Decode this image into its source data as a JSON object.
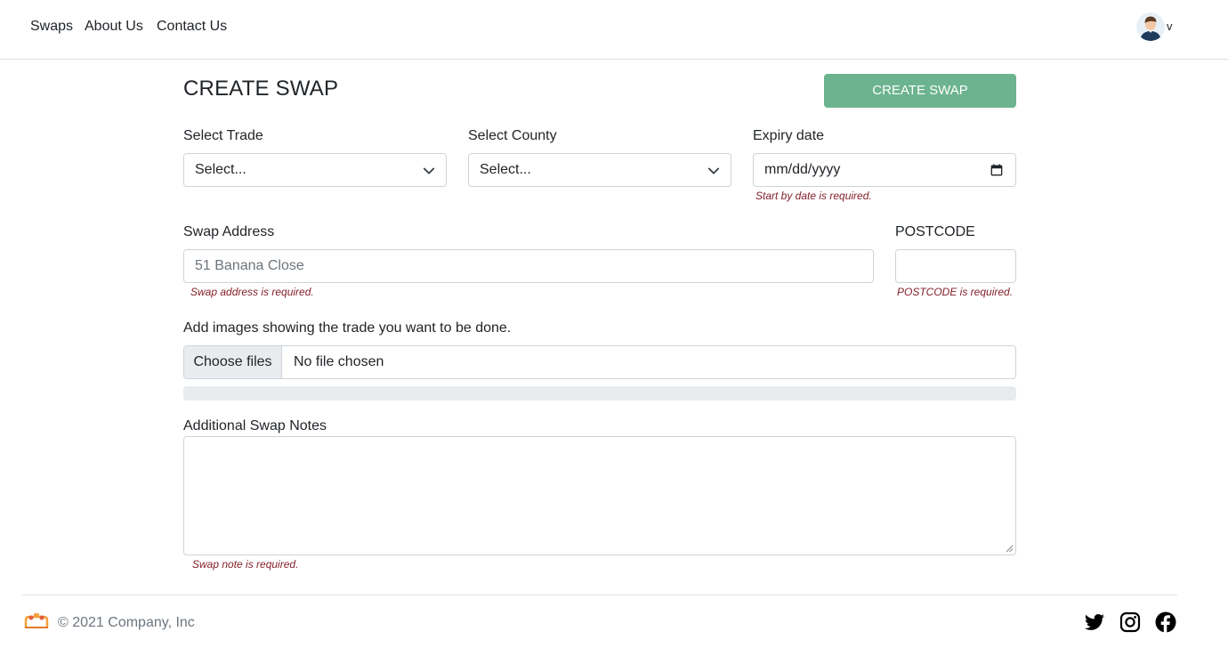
{
  "nav": {
    "links": [
      "Swaps",
      "About Us",
      "Contact Us"
    ],
    "avatar_caret": "v"
  },
  "page": {
    "title": "CREATE SWAP",
    "create_button": "CREATE SWAP"
  },
  "form": {
    "trade": {
      "label": "Select Trade",
      "value": "Select..."
    },
    "county": {
      "label": "Select County",
      "value": "Select..."
    },
    "expiry": {
      "label": "Expiry date",
      "placeholder": "mm/dd/yyyy",
      "error": "Start by date is required."
    },
    "address": {
      "label": "Swap Address",
      "placeholder": "51 Banana Close",
      "error": "Swap address is required."
    },
    "postcode": {
      "label": "POSTCODE",
      "value": "",
      "error": "POSTCODE is required."
    },
    "images": {
      "label": "Add images showing the trade you want to be done.",
      "button": "Choose files",
      "status": "No file chosen",
      "progress": 0
    },
    "notes": {
      "label": "Additional Swap Notes",
      "value": "",
      "error": "Swap note is required."
    }
  },
  "footer": {
    "copyright": "© 2021 Company, Inc",
    "social_icons": [
      "twitter-icon",
      "instagram-icon",
      "facebook-icon"
    ]
  },
  "colors": {
    "accent": "#6cb38f",
    "error": "#842029",
    "border": "#ced4da",
    "muted": "#6c757d"
  }
}
